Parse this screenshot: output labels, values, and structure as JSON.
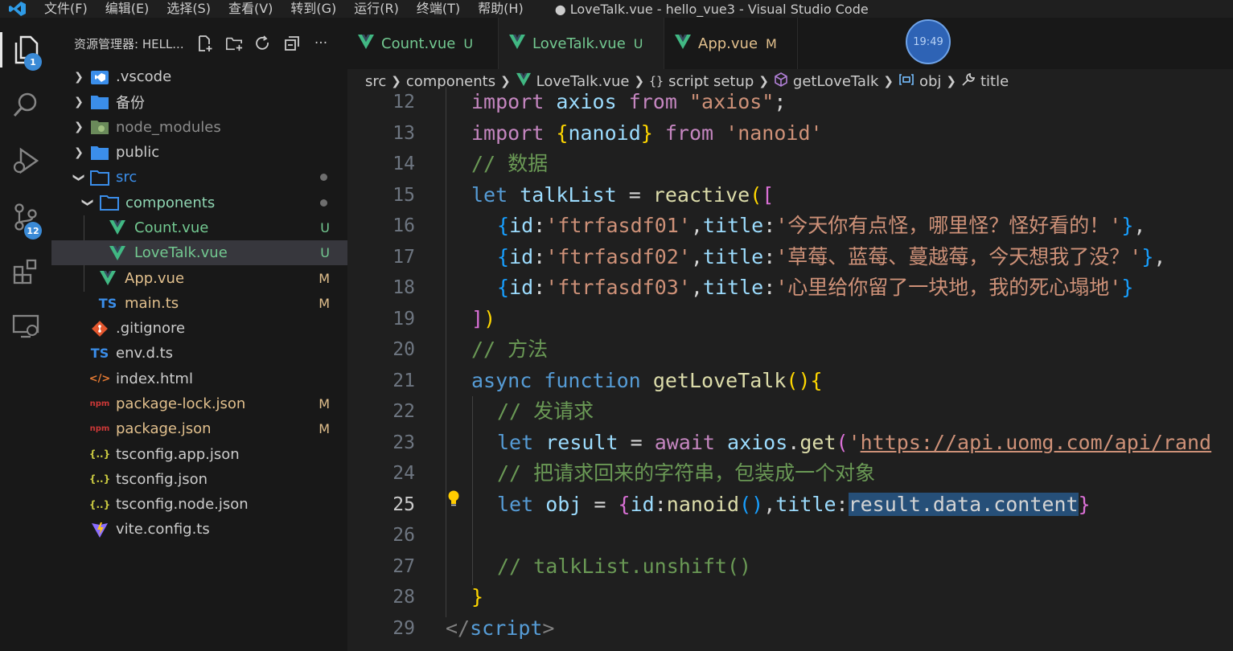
{
  "titlebar": {
    "menu": [
      "文件(F)",
      "编辑(E)",
      "选择(S)",
      "查看(V)",
      "转到(G)",
      "运行(R)",
      "终端(T)",
      "帮助(H)"
    ],
    "window_title": "● LoveTalk.vue - hello_vue3 - Visual Studio Code"
  },
  "activitybar": {
    "explorer_badge": "1",
    "scm_badge": "12"
  },
  "sidebar": {
    "title": "资源管理器: HELL...",
    "tree": [
      {
        "name": ".vscode",
        "status": ""
      },
      {
        "name": "备份",
        "status": ""
      },
      {
        "name": "node_modules",
        "status": ""
      },
      {
        "name": "public",
        "status": ""
      },
      {
        "name": "src",
        "status": ""
      },
      {
        "name": "components",
        "status": ""
      },
      {
        "name": "Count.vue",
        "status": "U"
      },
      {
        "name": "LoveTalk.vue",
        "status": "U"
      },
      {
        "name": "App.vue",
        "status": "M"
      },
      {
        "name": "main.ts",
        "status": "M"
      },
      {
        "name": ".gitignore",
        "status": ""
      },
      {
        "name": "env.d.ts",
        "status": ""
      },
      {
        "name": "index.html",
        "status": ""
      },
      {
        "name": "package-lock.json",
        "status": "M"
      },
      {
        "name": "package.json",
        "status": "M"
      },
      {
        "name": "tsconfig.app.json",
        "status": ""
      },
      {
        "name": "tsconfig.json",
        "status": ""
      },
      {
        "name": "tsconfig.node.json",
        "status": ""
      },
      {
        "name": "vite.config.ts",
        "status": ""
      }
    ],
    "icon_labels": {
      "ts": "TS",
      "json": "{..}",
      "html": "</>",
      "npm": "npm"
    }
  },
  "tabs": [
    {
      "label": "Count.vue",
      "status": "U"
    },
    {
      "label": "LoveTalk.vue",
      "status": "U"
    },
    {
      "label": "App.vue",
      "status": "M"
    }
  ],
  "clock": "19:49",
  "breadcrumb": {
    "src": "src",
    "components": "components",
    "file": "LoveTalk.vue",
    "block": "script setup",
    "fn": "getLoveTalk",
    "obj": "obj",
    "prop": "title"
  },
  "code": {
    "line_numbers": [
      "12",
      "13",
      "14",
      "15",
      "16",
      "17",
      "18",
      "19",
      "20",
      "21",
      "22",
      "23",
      "24",
      "25",
      "26",
      "27",
      "28",
      "29"
    ],
    "current_line": "25",
    "selected_text": "result.data.content",
    "strings": {
      "s12": "\"axios\"",
      "s13": "'nanoid'",
      "c14": "// 数据",
      "s16a": "'ftrfasdf01'",
      "s16b": "'今天你有点怪，哪里怪？怪好看的！'",
      "s17a": "'ftrfasdf02'",
      "s17b": "'草莓、蓝莓、蔓越莓，今天想我了没？'",
      "s18a": "'ftrfasdf03'",
      "s18b": "'心里给你留了一块地，我的死心塌地'",
      "c20": "// 方法",
      "c22": "// 发请求",
      "s23": "https://api.uomg.com/api/rand",
      "c24": "// 把请求回来的字符串，包装成一个对象",
      "c27": "// talkList.unshift()"
    }
  },
  "colors": {
    "accent_blue": "#3a8ad6",
    "vue_green": "#41b883",
    "modified": "#e2c08d",
    "untracked": "#73c991"
  }
}
